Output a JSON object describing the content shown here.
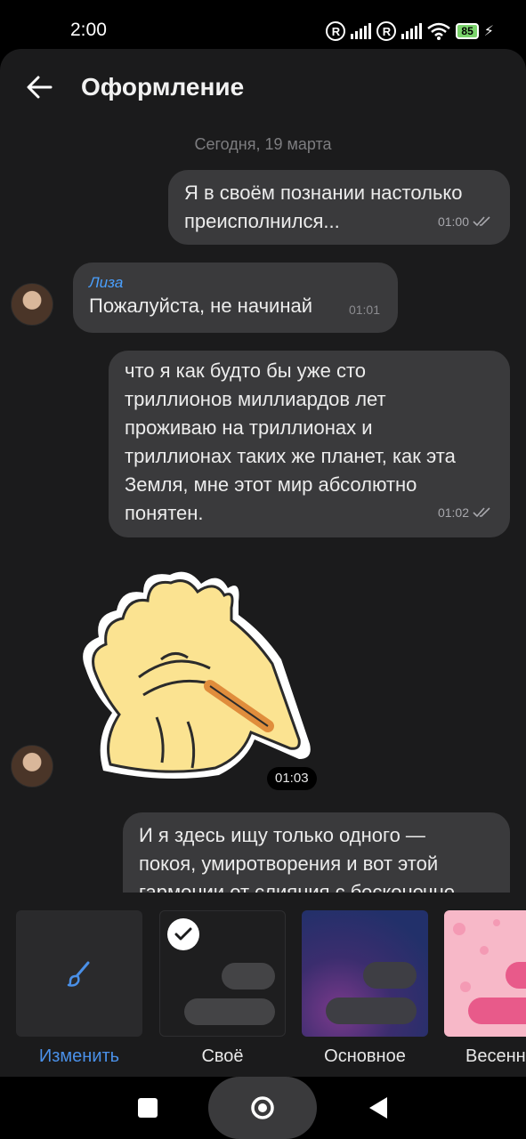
{
  "status_bar": {
    "time": "2:00",
    "battery": "85"
  },
  "header": {
    "title": "Оформление"
  },
  "chat": {
    "date_label": "Сегодня, 19 марта",
    "messages": [
      {
        "text_lines": [
          "Я в своём познании настолько",
          "преисполнился..."
        ],
        "time": "01:00"
      },
      {
        "sender": "Лиза",
        "text": "Пожалуйста, не начинай",
        "time": "01:01"
      },
      {
        "text_lines": [
          "что я как будто бы уже сто",
          "триллионов миллиардов лет",
          "проживаю на триллионах и",
          "триллионах таких же планет, как эта",
          "Земля, мне этот мир абсолютно",
          "понятен."
        ],
        "time": "01:02"
      },
      {
        "sticker": "facepalm-bird-sticker",
        "time": "01:03"
      },
      {
        "text_lines": [
          "И я здесь ищу только одного —",
          "покоя, умиротворения и вот этой",
          "гармонии от слияния с бесконечно"
        ]
      }
    ]
  },
  "themes": [
    {
      "label": "Изменить",
      "icon": "brush-icon",
      "label_color": "#4a90e8"
    },
    {
      "label": "Своё",
      "selected": true
    },
    {
      "label": "Основное"
    },
    {
      "label": "Весенн"
    }
  ],
  "colors": {
    "accent": "#4aa0ff",
    "bubble": "#3a3a3c",
    "background": "#1b1b1c"
  }
}
